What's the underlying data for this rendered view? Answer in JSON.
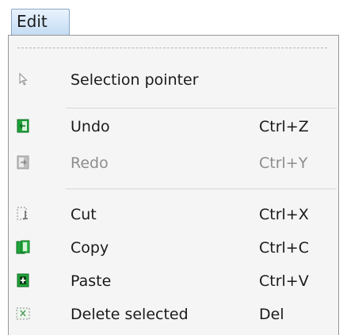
{
  "menubar": {
    "edit_label": "Edit"
  },
  "menu": {
    "items": [
      {
        "label": "Selection pointer",
        "shortcut": "",
        "icon": "selection-pointer-icon",
        "enabled": true
      },
      {
        "label": "Undo",
        "shortcut": "Ctrl+Z",
        "icon": "undo-icon",
        "enabled": true
      },
      {
        "label": "Redo",
        "shortcut": "Ctrl+Y",
        "icon": "redo-icon",
        "enabled": false
      },
      {
        "label": "Cut",
        "shortcut": "Ctrl+X",
        "icon": "cut-icon",
        "enabled": true
      },
      {
        "label": "Copy",
        "shortcut": "Ctrl+C",
        "icon": "copy-icon",
        "enabled": true
      },
      {
        "label": "Paste",
        "shortcut": "Ctrl+V",
        "icon": "paste-icon",
        "enabled": true
      },
      {
        "label": "Delete selected",
        "shortcut": "Del",
        "icon": "delete-selected-icon",
        "enabled": true
      }
    ]
  },
  "colors": {
    "menu_background": "#f5f5f5",
    "icon_green": "#1fa33a",
    "disabled_text": "#8d8d8d"
  }
}
